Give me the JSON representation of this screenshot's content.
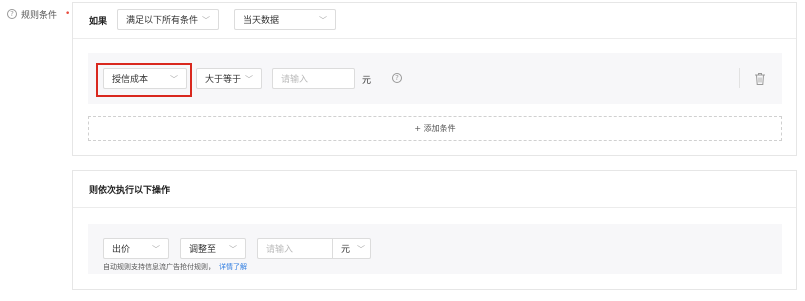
{
  "rule_label": "规则条件",
  "required_mark": "•",
  "condition": {
    "if_label": "如果",
    "match_select": "满足以下所有条件",
    "scope_select": "当天数据",
    "row": {
      "metric_select": "授信成本",
      "operator_select": "大于等于",
      "value_placeholder": "请输入",
      "unit": "元"
    },
    "add_condition": "+ 添加条件"
  },
  "action": {
    "title": "则依次执行以下操作",
    "action_select": "出价",
    "mode_select": "调整至",
    "value_placeholder": "请输入",
    "unit_select": "元",
    "hint_text": "自动规则支持信息流广告抢付规则，",
    "hint_link": "详情了解"
  },
  "colors": {
    "highlight": "#d9281e",
    "link": "#2f7de1",
    "panel": "#f7f7f9"
  }
}
